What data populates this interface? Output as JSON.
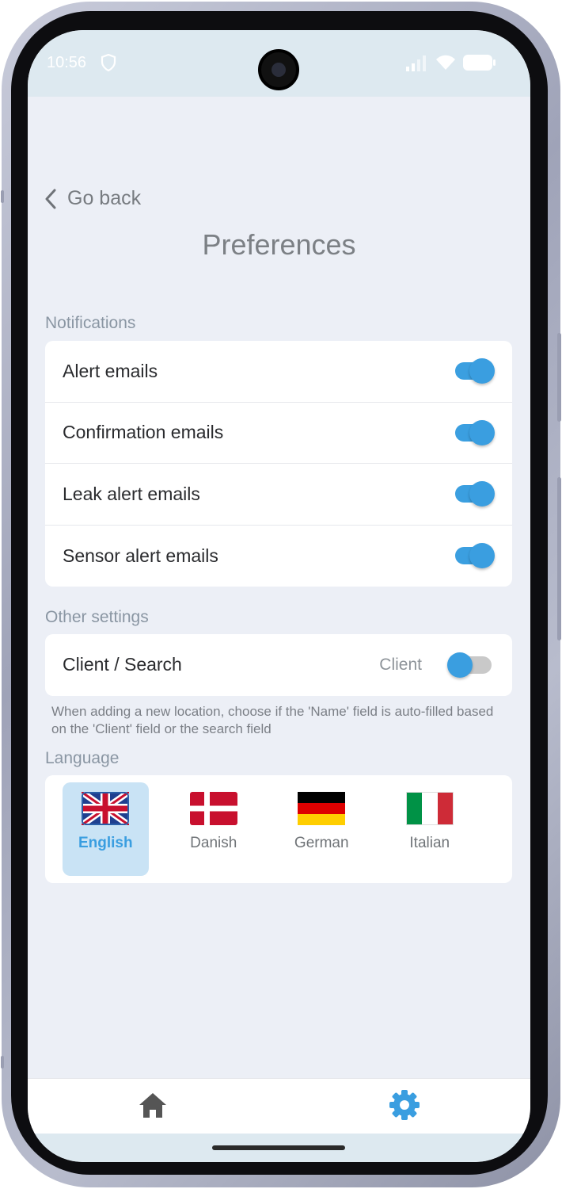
{
  "status_bar": {
    "time": "10:56"
  },
  "header": {
    "back_label": "Go back",
    "title": "Preferences"
  },
  "notifications": {
    "section_label": "Notifications",
    "items": [
      {
        "label": "Alert emails",
        "enabled": true
      },
      {
        "label": "Confirmation emails",
        "enabled": true
      },
      {
        "label": "Leak alert emails",
        "enabled": true
      },
      {
        "label": "Sensor alert emails",
        "enabled": true
      }
    ]
  },
  "other_settings": {
    "section_label": "Other settings",
    "client_search": {
      "label": "Client / Search",
      "value": "Client",
      "enabled": false
    },
    "helper_text": "When adding a new location, choose if the 'Name' field is auto-filled based on the 'Client' field or the search field"
  },
  "language": {
    "section_label": "Language",
    "options": [
      {
        "label": "English",
        "flag": "uk-flag-icon",
        "selected": true
      },
      {
        "label": "Danish",
        "flag": "denmark-flag-icon",
        "selected": false
      },
      {
        "label": "German",
        "flag": "germany-flag-icon",
        "selected": false
      },
      {
        "label": "Italian",
        "flag": "italy-flag-icon",
        "selected": false
      }
    ]
  },
  "bottom_nav": {
    "items": [
      {
        "icon": "home-icon",
        "active": false
      },
      {
        "icon": "gear-icon",
        "active": true
      }
    ]
  },
  "colors": {
    "accent": "#3a9ee0",
    "background": "#eceff6",
    "selected_bg": "#c9e3f5"
  }
}
